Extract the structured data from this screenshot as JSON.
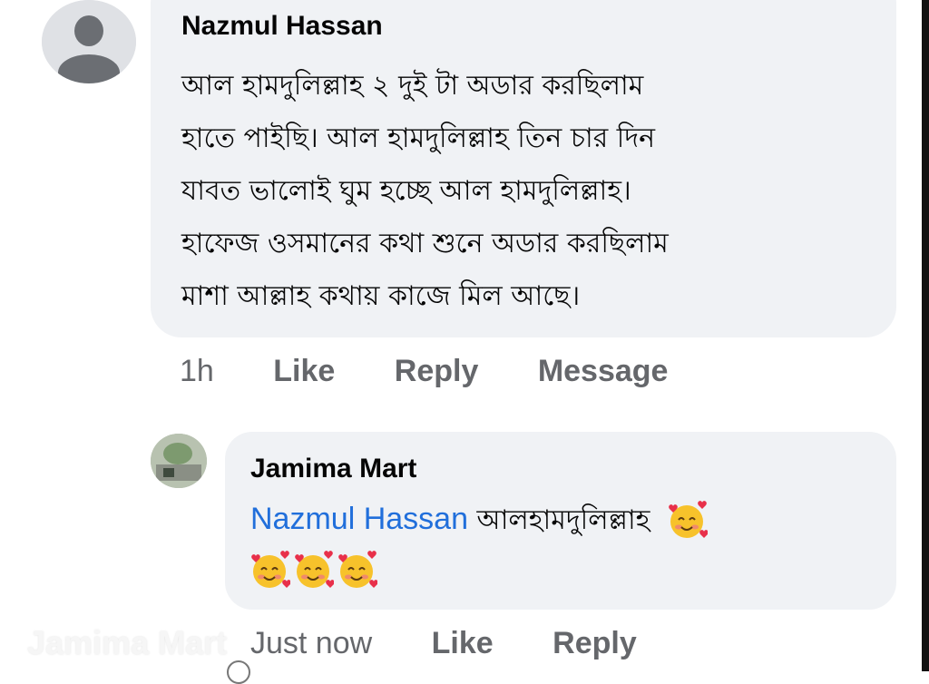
{
  "comment": {
    "author": "Nazmul Hassan",
    "lines": [
      "আল হামদুলিল্লাহ ২ দুই টা অডার করছিলাম",
      "হাতে পাইছি। আল হামদুলিল্লাহ তিন চার দিন",
      "যাবত ভালোই ঘুম হচ্ছে আল হামদুলিল্লাহ।",
      "হাফেজ ওসমানের কথা শুনে অডার করছিলাম",
      "মাশা আল্লাহ কথায় কাজে মিল আছে।"
    ],
    "actions": {
      "time": "1h",
      "like": "Like",
      "reply": "Reply",
      "message": "Message"
    }
  },
  "reply": {
    "author": "Jamima Mart",
    "mention": "Nazmul Hassan",
    "text": "আলহামদুলিল্লাহ",
    "emoji": "smiling-face-with-hearts",
    "emoji_count": 4,
    "actions": {
      "time": "Just now",
      "like": "Like",
      "reply": "Reply"
    }
  },
  "watermark": "Jamima Mart",
  "colors": {
    "bubble": "#f0f2f5",
    "mention": "#216fdb",
    "meta": "#65676b",
    "text": "#050505"
  }
}
